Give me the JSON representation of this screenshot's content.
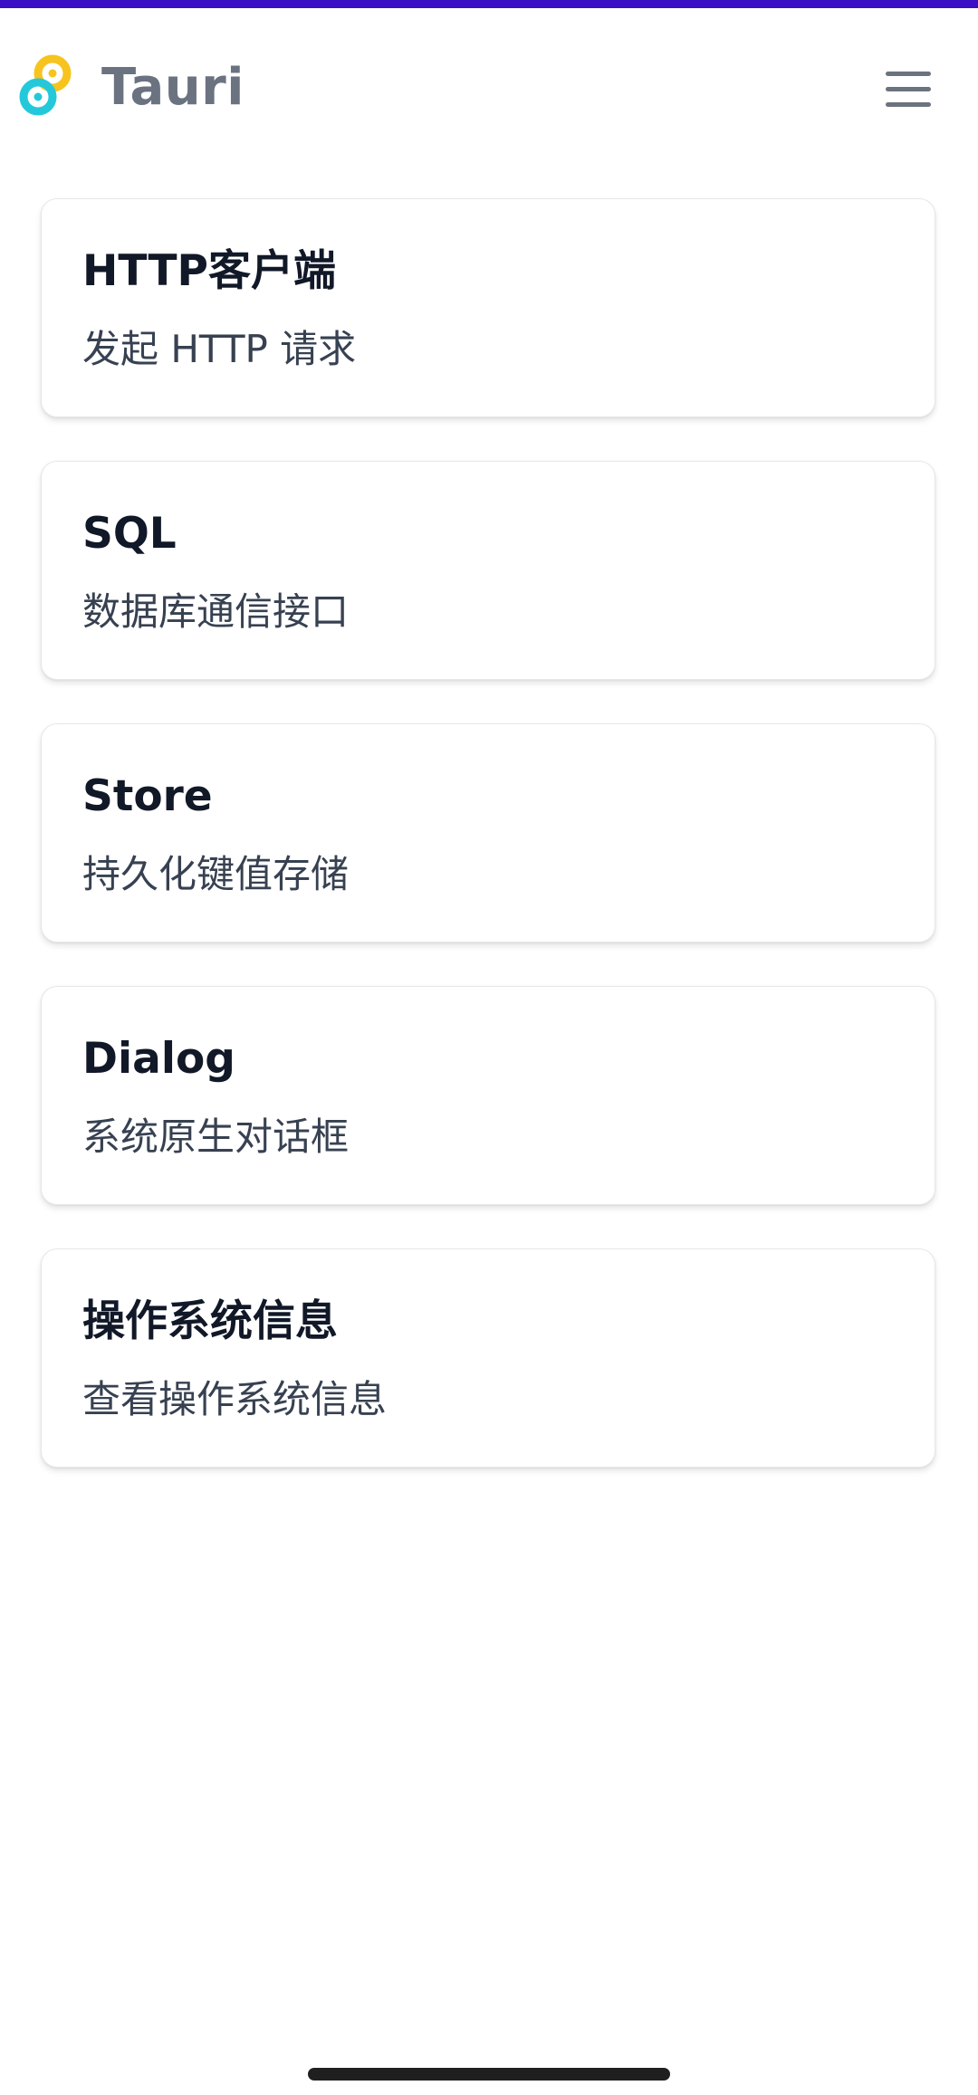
{
  "app": {
    "title": "Tauri",
    "accent_color": "#3b0fc4",
    "logo_icon": "tauri-logo-icon",
    "menu_icon": "hamburger-menu-icon"
  },
  "cards": [
    {
      "title": "HTTP客户端",
      "description": "发起 HTTP 请求"
    },
    {
      "title": "SQL",
      "description": "数据库通信接口"
    },
    {
      "title": "Store",
      "description": "持久化键值存储"
    },
    {
      "title": "Dialog",
      "description": "系统原生对话框"
    },
    {
      "title": "操作系统信息",
      "description": "查看操作系统信息"
    }
  ]
}
